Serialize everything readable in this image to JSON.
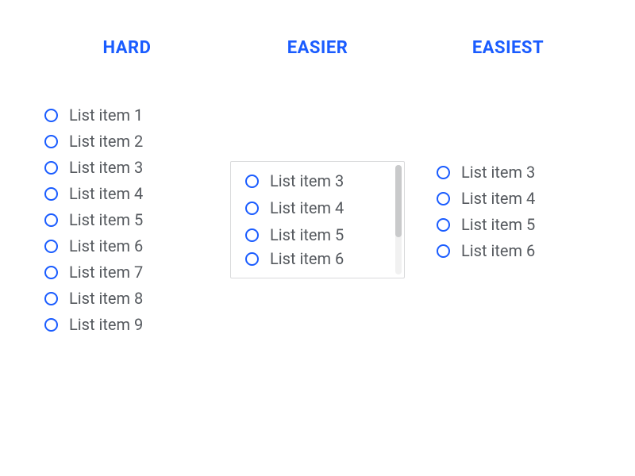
{
  "columns": {
    "hard": {
      "title": "HARD",
      "items": [
        "List item 1",
        "List item 2",
        "List item 3",
        "List item 4",
        "List item 5",
        "List item 6",
        "List item 7",
        "List item 8",
        "List item 9"
      ]
    },
    "easier": {
      "title": "EASIER",
      "visible_items": [
        "List item 3",
        "List item 4",
        "List item 5",
        "List item 6"
      ]
    },
    "easiest": {
      "title": "EASIEST",
      "items": [
        "List item 3",
        "List item 4",
        "List item 5",
        "List item 6"
      ]
    }
  },
  "colors": {
    "accent": "#1a5cff",
    "text": "#55595e",
    "border": "#d9dadb",
    "scrollbar_thumb": "#c9cacb"
  }
}
